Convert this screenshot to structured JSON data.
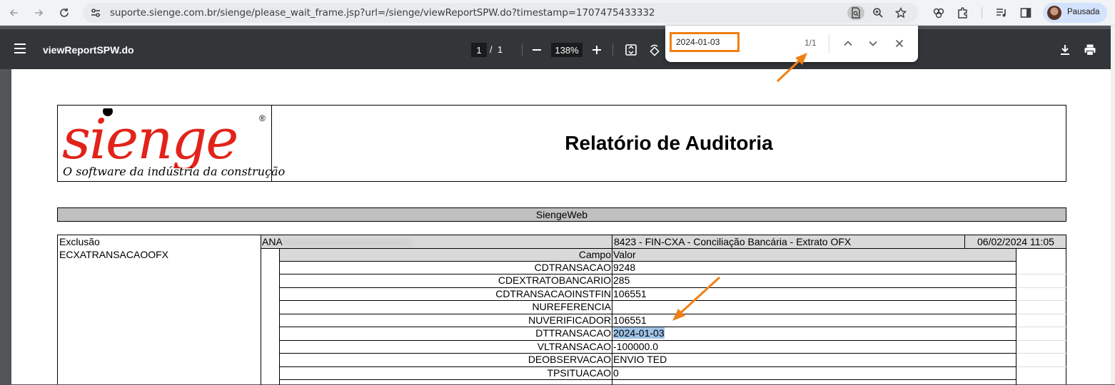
{
  "browser": {
    "url": "suporte.sienge.com.br/sienge/please_wait_frame.jsp?url=/sienge/viewReportSPW.do?timestamp=1707475433332",
    "profile_label": "Pausada"
  },
  "pdf_toolbar": {
    "title": "viewReportSPW.do",
    "current_page": "1",
    "page_separator": "/",
    "total_pages": "1",
    "zoom": "138%"
  },
  "find_bar": {
    "query": "2024-01-03",
    "match_count": "1/1"
  },
  "report": {
    "logo_tagline": "O software da indústria da construção",
    "title": "Relatório de Auditoria",
    "section": "SiengeWeb",
    "operation": "Exclusão",
    "table_name": "ECXATRANSACAOOFX",
    "user_prefix": "ANA",
    "module": "8423 - FIN-CXA - Conciliação Bancária - Extrato OFX",
    "datetime": "06/02/2024 11:05",
    "col_campo": "Campo",
    "col_valor": "Valor",
    "rows": [
      {
        "campo": "CDTRANSACAO",
        "valor": "9248"
      },
      {
        "campo": "CDEXTRATOBANCARIO",
        "valor": "285"
      },
      {
        "campo": "CDTRANSACAOINSTFIN",
        "valor": "106551"
      },
      {
        "campo": "NUREFERENCIA",
        "valor": ""
      },
      {
        "campo": "NUVERIFICADOR",
        "valor": "106551"
      },
      {
        "campo": "DTTRANSACAO",
        "valor": "2024-01-03"
      },
      {
        "campo": "VLTRANSACAO",
        "valor": "-100000.0"
      },
      {
        "campo": "DEOBSERVACAO",
        "valor": "ENVIO TED"
      },
      {
        "campo": "TPSITUACAO",
        "valor": "0"
      }
    ]
  },
  "colors": {
    "annotation_arrow": "#f07f13",
    "logo_red": "#e2231a",
    "search_highlight": "#9fc3e7"
  }
}
